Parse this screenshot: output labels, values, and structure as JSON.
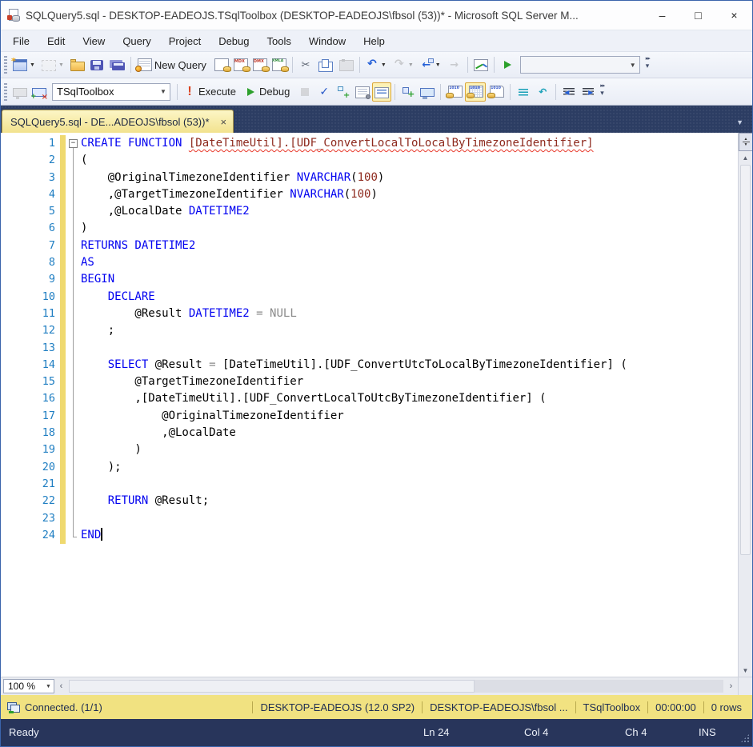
{
  "window": {
    "title": "SQLQuery5.sql - DESKTOP-EADEOJS.TSqlToolbox (DESKTOP-EADEOJS\\fbsol (53))* - Microsoft SQL Server M...",
    "controls": {
      "minimize": "–",
      "maximize": "□",
      "close": "×"
    }
  },
  "menu": {
    "items": [
      "File",
      "Edit",
      "View",
      "Query",
      "Project",
      "Debug",
      "Tools",
      "Window",
      "Help"
    ]
  },
  "toolbar_standard": {
    "items": [
      {
        "k": "grip",
        "name": "standard-toolbar-grip"
      },
      {
        "k": "btn",
        "name": "new-window-button",
        "icon": "newwin",
        "dd": true
      },
      {
        "k": "btn",
        "name": "add-item-button",
        "icon": "additem",
        "dd": true,
        "dis": true
      },
      {
        "k": "btn",
        "name": "open-file-button",
        "icon": "folder"
      },
      {
        "k": "btn",
        "name": "save-button",
        "icon": "save"
      },
      {
        "k": "btn",
        "name": "save-all-button",
        "icon": "saveall"
      },
      {
        "k": "sep"
      },
      {
        "k": "btn",
        "name": "new-query-button",
        "icon": "newquery",
        "label": "New Query"
      },
      {
        "k": "btn",
        "name": "database-engine-query-button",
        "icon": "dbquery"
      },
      {
        "k": "btn",
        "name": "mdx-query-button",
        "icon": "mdx"
      },
      {
        "k": "btn",
        "name": "dmx-query-button",
        "icon": "dmx"
      },
      {
        "k": "btn",
        "name": "xmla-query-button",
        "icon": "xmla"
      },
      {
        "k": "sep"
      },
      {
        "k": "btn",
        "name": "cut-button",
        "icon": "cut"
      },
      {
        "k": "btn",
        "name": "copy-button",
        "icon": "copy"
      },
      {
        "k": "btn",
        "name": "paste-button",
        "icon": "paste",
        "dis": true
      },
      {
        "k": "sep"
      },
      {
        "k": "btn",
        "name": "undo-button",
        "icon": "undo",
        "dd": true
      },
      {
        "k": "btn",
        "name": "redo-button",
        "icon": "redo",
        "dd": true,
        "dis": true
      },
      {
        "k": "btn",
        "name": "navigate-backward-button",
        "icon": "navback",
        "dd": true
      },
      {
        "k": "btn",
        "name": "navigate-forward-button",
        "icon": "navfwd",
        "dis": true
      },
      {
        "k": "sep"
      },
      {
        "k": "btn",
        "name": "activity-monitor-button",
        "icon": "activity"
      },
      {
        "k": "sep"
      },
      {
        "k": "btn",
        "name": "start-button",
        "icon": "play"
      },
      {
        "k": "combo",
        "name": "standard-combobox",
        "value": "",
        "width": 150,
        "dis": true
      },
      {
        "k": "overflow",
        "name": "standard-toolbar-options-button"
      }
    ]
  },
  "toolbar_sql": {
    "items": [
      {
        "k": "grip",
        "name": "sql-toolbar-grip"
      },
      {
        "k": "btn",
        "name": "connect-button",
        "icon": "connect",
        "dis": true
      },
      {
        "k": "btn",
        "name": "change-connection-button",
        "icon": "changeconn"
      },
      {
        "k": "combo",
        "name": "available-databases-combobox",
        "value": "TSqlToolbox",
        "width": 148
      },
      {
        "k": "sep"
      },
      {
        "k": "btn",
        "name": "execute-button",
        "icon": "exclaim",
        "label": "Execute"
      },
      {
        "k": "btn",
        "name": "debug-button",
        "icon": "play",
        "label": "Debug"
      },
      {
        "k": "btn",
        "name": "cancel-query-button",
        "icon": "stop",
        "dis": true
      },
      {
        "k": "btn",
        "name": "parse-button",
        "icon": "check"
      },
      {
        "k": "btn",
        "name": "estimated-plan-button",
        "icon": "plan"
      },
      {
        "k": "btn",
        "name": "query-options-button",
        "icon": "queryopt"
      },
      {
        "k": "btn",
        "name": "intellisense-enabled-button",
        "icon": "intelli",
        "sel": true
      },
      {
        "k": "sep"
      },
      {
        "k": "btn",
        "name": "template-parameters-button",
        "icon": "template"
      },
      {
        "k": "btn",
        "name": "client-statistics-button",
        "icon": "clientstats"
      },
      {
        "k": "sep"
      },
      {
        "k": "btn",
        "name": "results-to-text-button",
        "icon": "restext"
      },
      {
        "k": "btn",
        "name": "results-to-grid-button",
        "icon": "resgrid",
        "sel": true
      },
      {
        "k": "btn",
        "name": "results-to-file-button",
        "icon": "resfile"
      },
      {
        "k": "sep"
      },
      {
        "k": "btn",
        "name": "comment-button",
        "icon": "comment"
      },
      {
        "k": "btn",
        "name": "uncomment-button",
        "icon": "uncomment"
      },
      {
        "k": "sep"
      },
      {
        "k": "btn",
        "name": "decrease-indent-button",
        "icon": "outdent"
      },
      {
        "k": "btn",
        "name": "increase-indent-button",
        "icon": "indent"
      },
      {
        "k": "overflow",
        "name": "sql-toolbar-options-button"
      }
    ]
  },
  "tab": {
    "label": "SQLQuery5.sql - DE...ADEOJS\\fbsol (53))*",
    "close_glyph": "×"
  },
  "editor": {
    "lines": [
      {
        "n": "1",
        "fold": "-",
        "tokens": [
          [
            "CREATE FUNCTION ",
            "k"
          ],
          [
            "[DateTimeUtil].[UDF_ConvertLocalToLocalByTimezoneIdentifier]",
            "e"
          ]
        ]
      },
      {
        "n": "2",
        "fold": "|",
        "tokens": [
          [
            "(",
            "p"
          ]
        ]
      },
      {
        "n": "3",
        "fold": "|",
        "tokens": [
          [
            "    @OriginalTimezoneIdentifier ",
            "p"
          ],
          [
            "NVARCHAR",
            "k"
          ],
          [
            "(",
            "p"
          ],
          [
            "100",
            "m"
          ],
          [
            ")",
            "p"
          ]
        ]
      },
      {
        "n": "4",
        "fold": "|",
        "tokens": [
          [
            "    ,@TargetTimezoneIdentifier ",
            "p"
          ],
          [
            "NVARCHAR",
            "k"
          ],
          [
            "(",
            "p"
          ],
          [
            "100",
            "m"
          ],
          [
            ")",
            "p"
          ]
        ]
      },
      {
        "n": "5",
        "fold": "|",
        "tokens": [
          [
            "    ,@LocalDate ",
            "p"
          ],
          [
            "DATETIME2",
            "k"
          ]
        ]
      },
      {
        "n": "6",
        "fold": "|",
        "tokens": [
          [
            ")",
            "p"
          ]
        ]
      },
      {
        "n": "7",
        "fold": "|",
        "tokens": [
          [
            "RETURNS DATETIME2",
            "k"
          ]
        ]
      },
      {
        "n": "8",
        "fold": "|",
        "tokens": [
          [
            "AS",
            "k"
          ]
        ]
      },
      {
        "n": "9",
        "fold": "|",
        "tokens": [
          [
            "BEGIN",
            "k"
          ]
        ]
      },
      {
        "n": "10",
        "fold": "|",
        "tokens": [
          [
            "    ",
            "p"
          ],
          [
            "DECLARE",
            "k"
          ]
        ]
      },
      {
        "n": "11",
        "fold": "|",
        "tokens": [
          [
            "        @Result ",
            "p"
          ],
          [
            "DATETIME2",
            "k"
          ],
          [
            " ",
            "p"
          ],
          [
            "=",
            "g"
          ],
          [
            " ",
            "p"
          ],
          [
            "NULL",
            "g"
          ]
        ]
      },
      {
        "n": "12",
        "fold": "|",
        "tokens": [
          [
            "    ;",
            "p"
          ]
        ]
      },
      {
        "n": "13",
        "fold": "|",
        "tokens": []
      },
      {
        "n": "14",
        "fold": "|",
        "tokens": [
          [
            "    ",
            "p"
          ],
          [
            "SELECT",
            "k"
          ],
          [
            " @Result ",
            "p"
          ],
          [
            "=",
            "g"
          ],
          [
            " [DateTimeUtil].[UDF_ConvertUtcToLocalByTimezoneIdentifier] (",
            "p"
          ]
        ]
      },
      {
        "n": "15",
        "fold": "|",
        "tokens": [
          [
            "        @TargetTimezoneIdentifier",
            "p"
          ]
        ]
      },
      {
        "n": "16",
        "fold": "|",
        "tokens": [
          [
            "        ,[DateTimeUtil].[UDF_ConvertLocalToUtcByTimezoneIdentifier] (",
            "p"
          ]
        ]
      },
      {
        "n": "17",
        "fold": "|",
        "tokens": [
          [
            "            @OriginalTimezoneIdentifier",
            "p"
          ]
        ]
      },
      {
        "n": "18",
        "fold": "|",
        "tokens": [
          [
            "            ,@LocalDate",
            "p"
          ]
        ]
      },
      {
        "n": "19",
        "fold": "|",
        "tokens": [
          [
            "        )",
            "p"
          ]
        ]
      },
      {
        "n": "20",
        "fold": "|",
        "tokens": [
          [
            "    );",
            "p"
          ]
        ]
      },
      {
        "n": "21",
        "fold": "|",
        "tokens": []
      },
      {
        "n": "22",
        "fold": "|",
        "tokens": [
          [
            "    ",
            "p"
          ],
          [
            "RETURN",
            "k"
          ],
          [
            " @Result;",
            "p"
          ]
        ]
      },
      {
        "n": "23",
        "fold": "|",
        "tokens": []
      },
      {
        "n": "24",
        "fold": "L",
        "caret": true,
        "tokens": [
          [
            "END",
            "k"
          ]
        ]
      }
    ]
  },
  "zoom_control": {
    "value": "100 %"
  },
  "connection_bar": {
    "status": "Connected. (1/1)",
    "segments": [
      "DESKTOP-EADEOJS (12.0 SP2)",
      "DESKTOP-EADEOJS\\fbsol ...",
      "TSqlToolbox",
      "00:00:00",
      "0 rows"
    ]
  },
  "status_bar": {
    "state": "Ready",
    "ln": "Ln 24",
    "col": "Col 4",
    "ch": "Ch 4",
    "mode": "INS"
  },
  "colors": {
    "accent_tab": "#f2e28e",
    "keyword": "#0000f0",
    "error_identifier": "#8e2a1e",
    "connbar": "#f1e281",
    "statusbar": "#28355b"
  }
}
